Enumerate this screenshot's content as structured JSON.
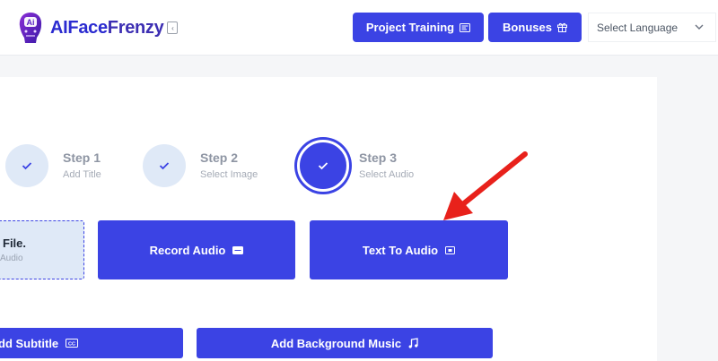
{
  "brand": {
    "name_part1": "AIFace",
    "name_part2": "Frenzy",
    "logo_badge": "Ai"
  },
  "header": {
    "project_training": "Project Training",
    "bonuses": "Bonuses",
    "language": "Select Language"
  },
  "steps": [
    {
      "title": "Step 1",
      "subtitle": "Add Title"
    },
    {
      "title": "Step 2",
      "subtitle": "Select Image"
    },
    {
      "title": "Step 3",
      "subtitle": "Select Audio"
    }
  ],
  "audio_options": {
    "upload_title": "File.",
    "upload_sub": "Audio",
    "record_audio": "Record Audio",
    "text_to_audio": "Text To Audio"
  },
  "extras": {
    "add_subtitle": "dd Subtitle",
    "add_background_music": "Add Background Music"
  },
  "colors": {
    "accent": "#3b43e4",
    "step_bg": "#dfe9f7",
    "arrow": "#e8211b"
  }
}
